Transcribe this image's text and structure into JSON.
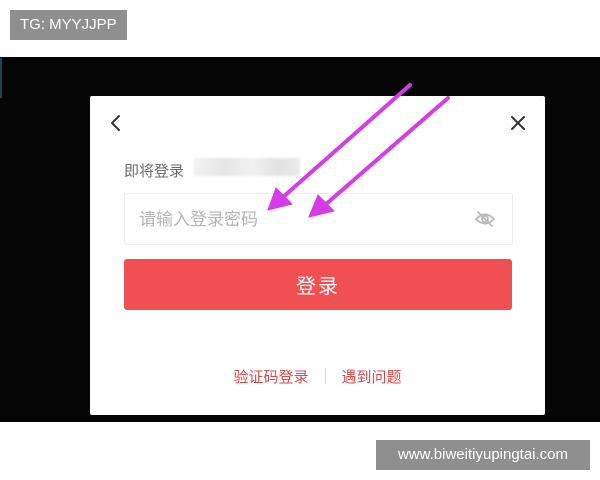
{
  "watermark_top": "TG: MYYJJPP",
  "watermark_bottom": "www.biweitiyupingtai.com",
  "dialog": {
    "back_icon": "chevron-left-icon",
    "close_icon": "close-icon",
    "login_as_label": "即将登录",
    "password_placeholder": "请输入登录密码",
    "visibility_icon": "eye-slash-icon",
    "login_button": "登录",
    "links": {
      "sms_login": "验证码登录",
      "help": "遇到问题"
    }
  },
  "colors": {
    "accent": "#f24f52",
    "link": "#e0474a",
    "annotation_arrow": "#d63ce6",
    "backdrop": "#050505",
    "watermark_bg": "#8f8f8f"
  }
}
